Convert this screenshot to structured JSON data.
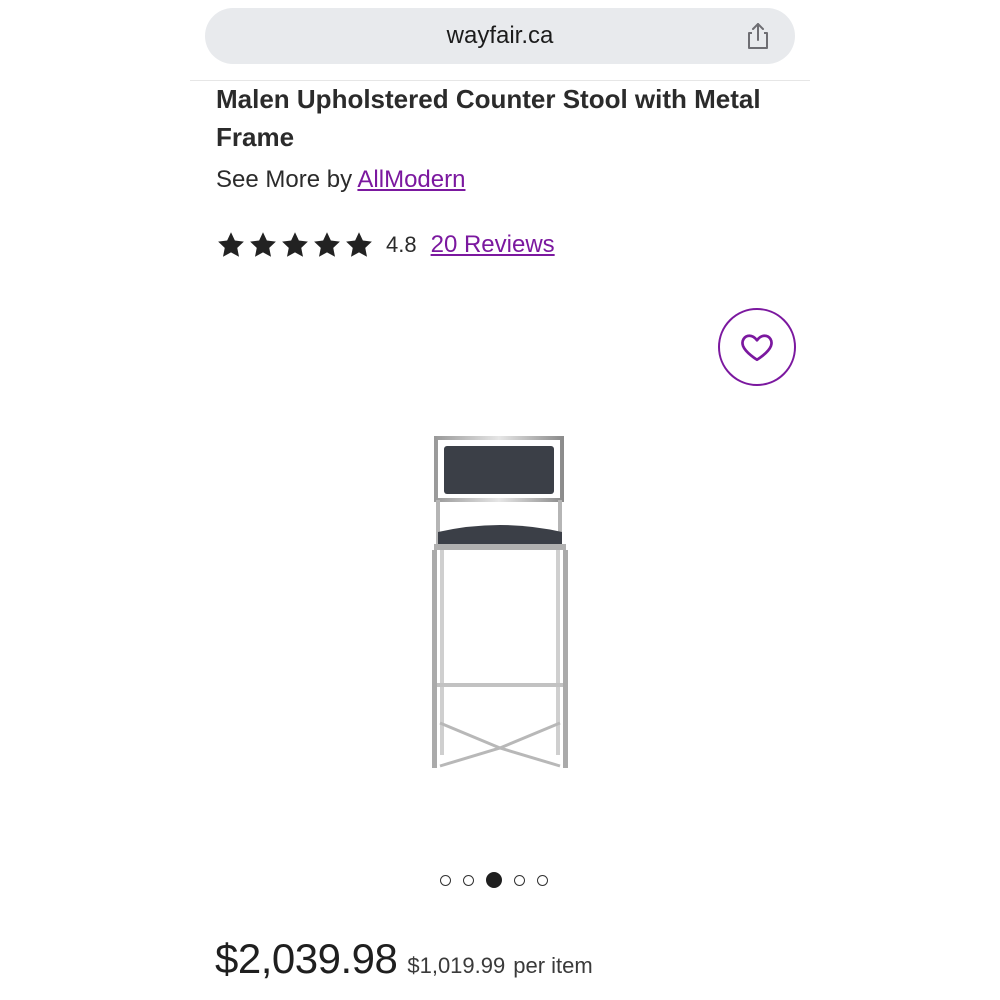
{
  "browser": {
    "url": "wayfair.ca",
    "share_icon": "share-icon"
  },
  "product": {
    "title": "Malen Upholstered Counter Stool with Metal Frame",
    "see_more_prefix": "See More by",
    "brand": "AllModern",
    "rating_value": "4.8",
    "stars_filled": 5,
    "reviews_label": "20 Reviews",
    "favorite_icon": "heart-icon"
  },
  "carousel": {
    "total_slides": 5,
    "active_index": 2
  },
  "pricing": {
    "price": "$2,039.98",
    "unit_price": "$1,019.99",
    "unit_label": "per item"
  },
  "colors": {
    "accent": "#7b189f",
    "text": "#2b2b2b",
    "url_bar_bg": "#e8eaed"
  }
}
